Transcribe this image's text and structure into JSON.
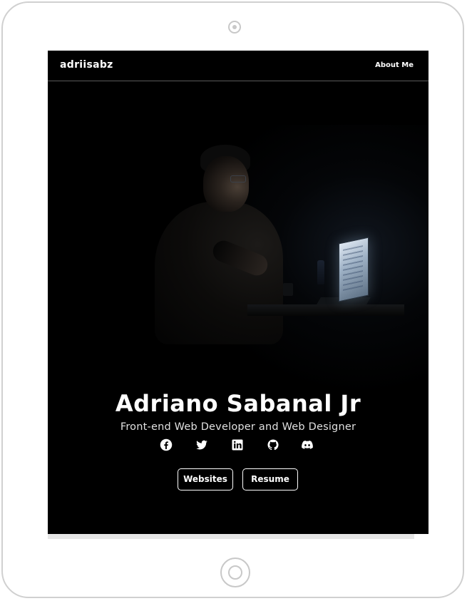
{
  "nav": {
    "logo": "adriisabz",
    "links": [
      {
        "label": "About Me"
      }
    ]
  },
  "hero": {
    "title": "Adriano Sabanal Jr",
    "subtitle": "Front-end Web Developer and Web Designer",
    "socials": [
      {
        "icon": "facebook-icon"
      },
      {
        "icon": "twitter-icon"
      },
      {
        "icon": "linkedin-icon"
      },
      {
        "icon": "github-icon"
      },
      {
        "icon": "discord-icon"
      }
    ],
    "buttons": [
      {
        "label": "Websites"
      },
      {
        "label": "Resume"
      }
    ]
  },
  "colors": {
    "background": "#000000",
    "text": "#ffffff",
    "device_frame": "#d0d0d0"
  }
}
